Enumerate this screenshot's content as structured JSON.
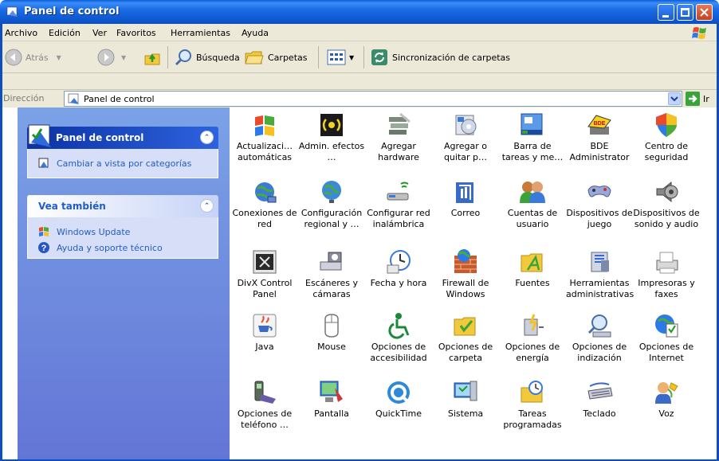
{
  "window": {
    "title": "Panel de control"
  },
  "menu": [
    "Archivo",
    "Edición",
    "Ver",
    "Favoritos",
    "Herramientas",
    "Ayuda"
  ],
  "toolbar": {
    "back_label": "Atrás",
    "search_label": "Búsqueda",
    "folders_label": "Carpetas",
    "sync_label": "Sincronización de carpetas"
  },
  "address": {
    "label": "Dirección",
    "value": "Panel de control",
    "go_label": "Ir"
  },
  "taskpane": {
    "main": {
      "title": "Panel de control",
      "link": "Cambiar a vista por categorías"
    },
    "see_also": {
      "title": "Vea también",
      "links": [
        "Windows Update",
        "Ayuda y soporte técnico"
      ]
    }
  },
  "items": [
    {
      "label": "Actualizaci… automáticas",
      "icon": "automatic-updates-icon"
    },
    {
      "label": "Admin. efectos …",
      "icon": "effects-admin-icon"
    },
    {
      "label": "Agregar hardware",
      "icon": "add-hardware-icon"
    },
    {
      "label": "Agregar o quitar p…",
      "icon": "add-remove-programs-icon"
    },
    {
      "label": "Barra de tareas y me…",
      "icon": "taskbar-icon"
    },
    {
      "label": "BDE Administrator",
      "icon": "bde-admin-icon"
    },
    {
      "label": "Centro de seguridad",
      "icon": "security-center-icon"
    },
    {
      "label": "Conexiones de red",
      "icon": "network-connections-icon"
    },
    {
      "label": "Configuración regional y …",
      "icon": "regional-settings-icon"
    },
    {
      "label": "Configurar red inalámbrica",
      "icon": "wireless-setup-icon"
    },
    {
      "label": "Correo",
      "icon": "mail-icon"
    },
    {
      "label": "Cuentas de usuario",
      "icon": "user-accounts-icon"
    },
    {
      "label": "Dispositivos de juego",
      "icon": "game-controllers-icon"
    },
    {
      "label": "Dispositivos de sonido y audio",
      "icon": "sound-devices-icon"
    },
    {
      "label": "DivX Control Panel",
      "icon": "divx-icon"
    },
    {
      "label": "Escáneres y cámaras",
      "icon": "scanners-cameras-icon"
    },
    {
      "label": "Fecha y hora",
      "icon": "date-time-icon"
    },
    {
      "label": "Firewall de Windows",
      "icon": "firewall-icon"
    },
    {
      "label": "Fuentes",
      "icon": "fonts-icon"
    },
    {
      "label": "Herramientas administrativas",
      "icon": "admin-tools-icon"
    },
    {
      "label": "Impresoras y faxes",
      "icon": "printers-faxes-icon"
    },
    {
      "label": "Java",
      "icon": "java-icon"
    },
    {
      "label": "Mouse",
      "icon": "mouse-icon"
    },
    {
      "label": "Opciones de accesibilidad",
      "icon": "accessibility-icon"
    },
    {
      "label": "Opciones de carpeta",
      "icon": "folder-options-icon"
    },
    {
      "label": "Opciones de energía",
      "icon": "power-options-icon"
    },
    {
      "label": "Opciones de indización",
      "icon": "indexing-options-icon"
    },
    {
      "label": "Opciones de Internet",
      "icon": "internet-options-icon"
    },
    {
      "label": "Opciones de teléfono …",
      "icon": "phone-options-icon"
    },
    {
      "label": "Pantalla",
      "icon": "display-icon"
    },
    {
      "label": "QuickTime",
      "icon": "quicktime-icon"
    },
    {
      "label": "Sistema",
      "icon": "system-icon"
    },
    {
      "label": "Tareas programadas",
      "icon": "scheduled-tasks-icon"
    },
    {
      "label": "Teclado",
      "icon": "keyboard-icon"
    },
    {
      "label": "Voz",
      "icon": "speech-icon"
    }
  ]
}
